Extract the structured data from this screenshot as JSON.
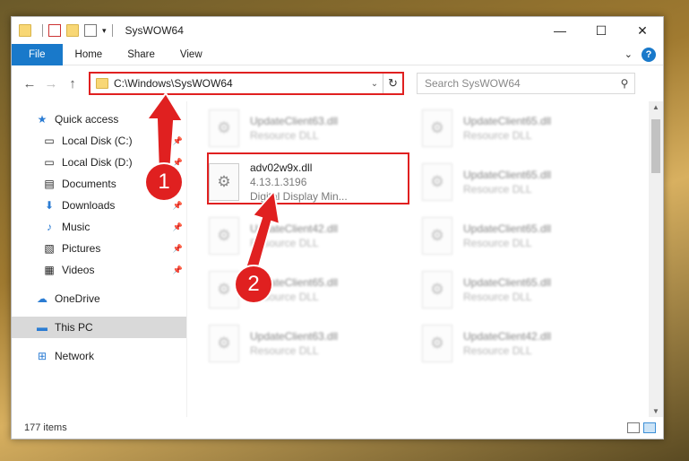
{
  "title": "SysWOW64",
  "window_controls": {
    "minimize": "—",
    "maximize": "☐",
    "close": "✕"
  },
  "ribbon": {
    "tabs": [
      "File",
      "Home",
      "Share",
      "View"
    ],
    "expand": "⌄",
    "help": "?"
  },
  "nav": {
    "back": "←",
    "forward": "→",
    "up": "↑",
    "address": "C:\\Windows\\SysWOW64",
    "dropdown": "⌄",
    "refresh": "↻",
    "search_placeholder": "Search SysWOW64",
    "search_icon": "⚲"
  },
  "sidebar": {
    "quick_access": "Quick access",
    "items": [
      {
        "label": "Local Disk (C:)",
        "icon": "drive-icon",
        "pinned": true
      },
      {
        "label": "Local Disk (D:)",
        "icon": "drive-icon",
        "pinned": true
      },
      {
        "label": "Documents",
        "icon": "documents-icon",
        "pinned": true
      },
      {
        "label": "Downloads",
        "icon": "downloads-icon",
        "pinned": true
      },
      {
        "label": "Music",
        "icon": "music-icon",
        "pinned": true
      },
      {
        "label": "Pictures",
        "icon": "pictures-icon",
        "pinned": true
      },
      {
        "label": "Videos",
        "icon": "videos-icon",
        "pinned": true
      }
    ],
    "onedrive": "OneDrive",
    "this_pc": "This PC",
    "network": "Network"
  },
  "files": [
    {
      "name": "UpdateClient63.dll",
      "sub": "Resource DLL",
      "blurred": true
    },
    {
      "name": "UpdateClient65.dll",
      "sub": "Resource DLL",
      "blurred": true
    },
    {
      "name": "adv02w9x.dll",
      "sub": "4.13.1.3196",
      "sub2": "Digital Display Min...",
      "blurred": false
    },
    {
      "name": "UpdateClient65.dll",
      "sub": "Resource DLL",
      "blurred": true
    },
    {
      "name": "UpdateClient42.dll",
      "sub": "Resource DLL",
      "blurred": true
    },
    {
      "name": "UpdateClient65.dll",
      "sub": "Resource DLL",
      "blurred": true
    },
    {
      "name": "UpdateClient65.dll",
      "sub": "Resource DLL",
      "blurred": true
    },
    {
      "name": "UpdateClient65.dll",
      "sub": "Resource DLL",
      "blurred": true
    },
    {
      "name": "UpdateClient63.dll",
      "sub": "Resource DLL",
      "blurred": true
    },
    {
      "name": "UpdateClient42.dll",
      "sub": "Resource DLL",
      "blurred": true
    }
  ],
  "status": {
    "item_count": "177 items"
  },
  "annotations": {
    "step1": "1",
    "step2": "2",
    "color": "#e02020"
  }
}
